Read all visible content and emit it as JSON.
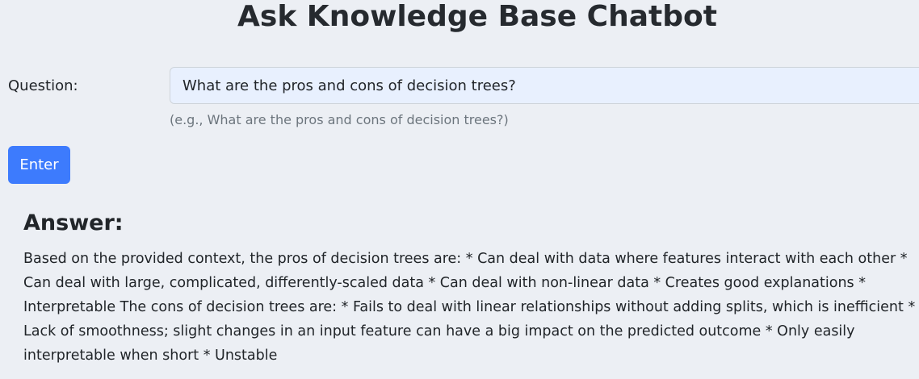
{
  "page": {
    "title": "Ask Knowledge Base Chatbot"
  },
  "question": {
    "label": "Question:",
    "value": "What are the pros and cons of decision trees?",
    "help_text": "(e.g., What are the pros and cons of decision trees?)"
  },
  "enter_button": {
    "label": "Enter",
    "color": "#3d7bfd"
  },
  "answer": {
    "heading": "Answer:",
    "text": "Based on the provided context, the pros of decision trees are: * Can deal with data where features interact with each other * Can deal with large, complicated, differently-scaled data * Can deal with non-linear data * Creates good explanations * Interpretable The cons of decision trees are: * Fails to deal with linear relationships without adding splits, which is inefficient * Lack of smoothness; slight changes in an input feature can have a big impact on the predicted outcome * Only easily interpretable when short * Unstable"
  }
}
